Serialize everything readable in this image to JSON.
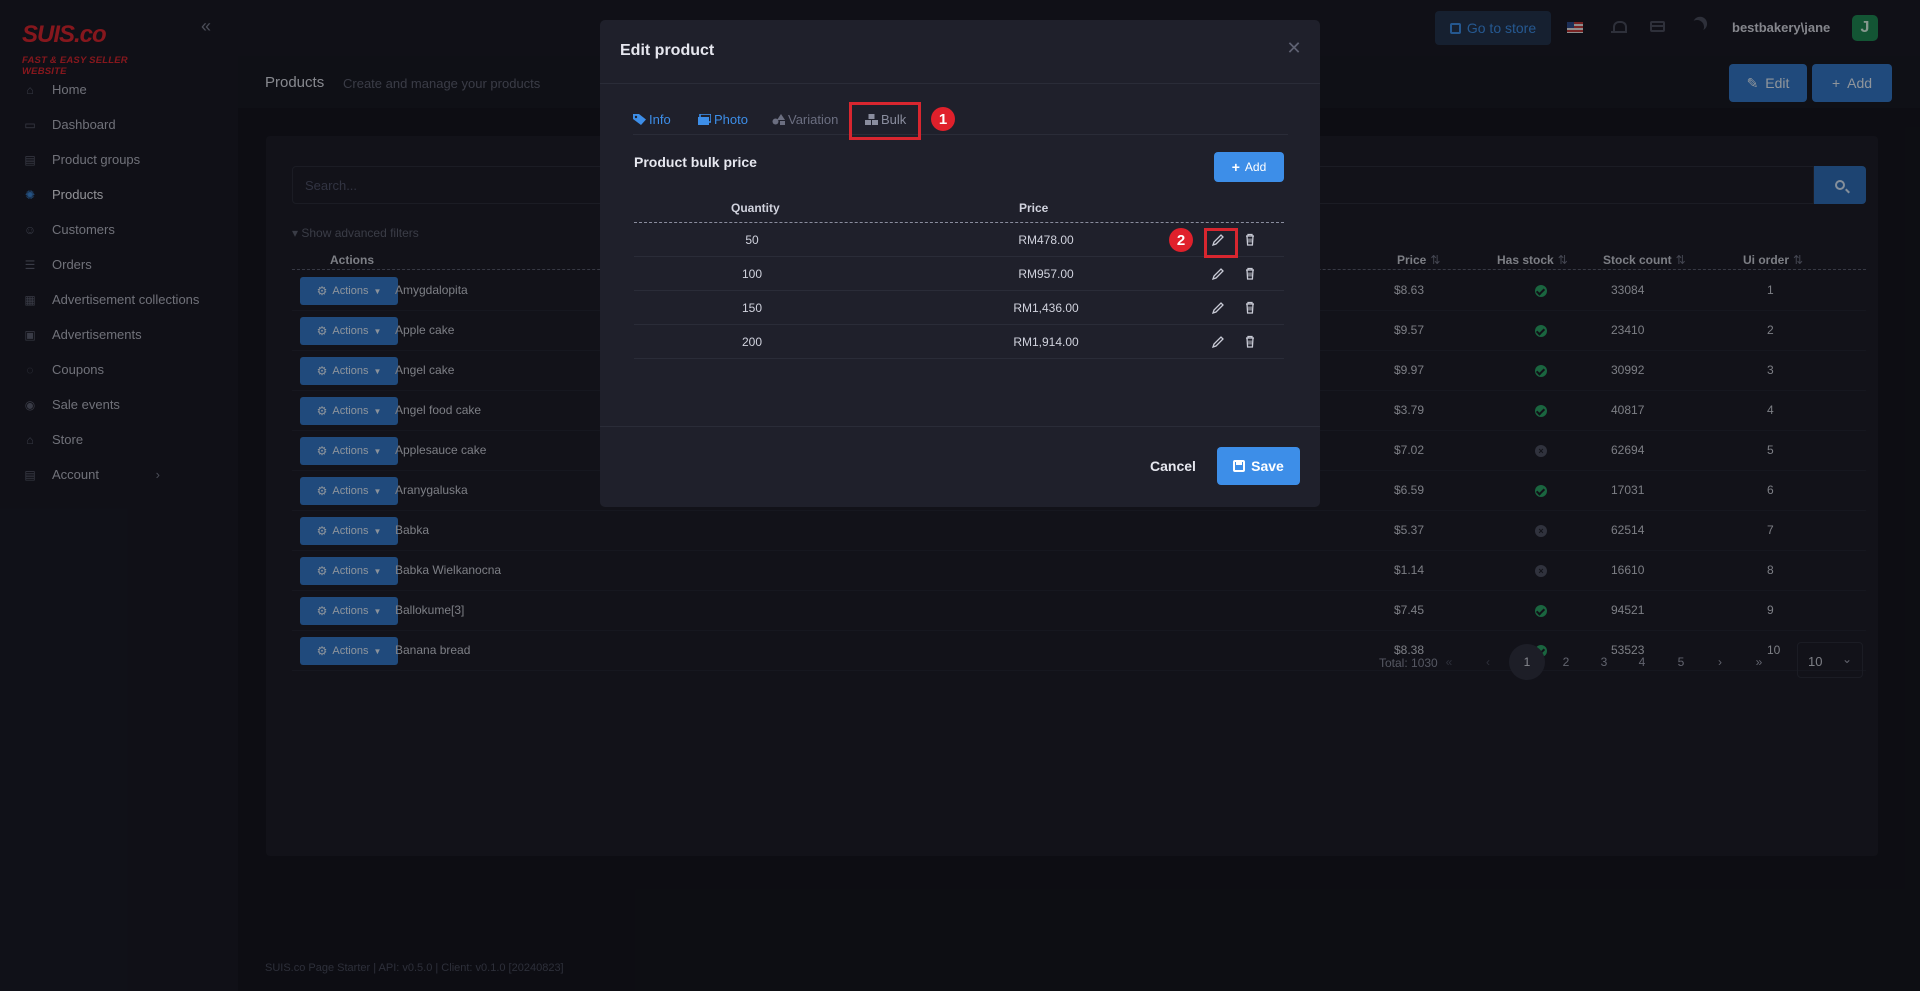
{
  "brand": {
    "logo_main": "SUIS",
    "logo_suffix": ".co",
    "logo_tagline": "FAST & EASY SELLER WEBSITE"
  },
  "sidebar": {
    "items": [
      {
        "label": "Home",
        "icon": "home-icon"
      },
      {
        "label": "Dashboard",
        "icon": "dashboard-icon"
      },
      {
        "label": "Product groups",
        "icon": "product-groups-icon"
      },
      {
        "label": "Products",
        "icon": "products-icon",
        "active": true
      },
      {
        "label": "Customers",
        "icon": "customers-icon"
      },
      {
        "label": "Orders",
        "icon": "orders-icon"
      },
      {
        "label": "Advertisement collections",
        "icon": "ad-collections-icon"
      },
      {
        "label": "Advertisements",
        "icon": "advertisements-icon"
      },
      {
        "label": "Coupons",
        "icon": "coupons-icon"
      },
      {
        "label": "Sale events",
        "icon": "sale-events-icon"
      },
      {
        "label": "Store",
        "icon": "store-icon"
      },
      {
        "label": "Account",
        "icon": "account-icon",
        "chevron": "›"
      }
    ]
  },
  "topbar": {
    "go_to_store": "Go to store",
    "user": "bestbakery\\jane",
    "avatar_initial": "J"
  },
  "page": {
    "title": "Products",
    "subtitle": "Create and manage your products",
    "edit_btn": "Edit",
    "add_btn": "Add"
  },
  "table": {
    "search_placeholder": "Search...",
    "advanced_filters": "Show advanced filters",
    "headers": {
      "actions": "Actions",
      "price": "Price",
      "has_stock": "Has stock",
      "stock_count": "Stock count",
      "ui_order": "Ui order"
    },
    "action_label": "Actions",
    "rows": [
      {
        "name": "Amygdalopita",
        "price": "$8.63",
        "stock": true,
        "count": "33084",
        "order": "1"
      },
      {
        "name": "Apple cake",
        "price": "$9.57",
        "stock": true,
        "count": "23410",
        "order": "2"
      },
      {
        "name": "Angel cake",
        "price": "$9.97",
        "stock": true,
        "count": "30992",
        "order": "3"
      },
      {
        "name": "Angel food cake",
        "price": "$3.79",
        "stock": true,
        "count": "40817",
        "order": "4"
      },
      {
        "name": "Applesauce cake",
        "price": "$7.02",
        "stock": false,
        "count": "62694",
        "order": "5"
      },
      {
        "name": "Aranygaluska",
        "price": "$6.59",
        "stock": true,
        "count": "17031",
        "order": "6"
      },
      {
        "name": "Babka",
        "price": "$5.37",
        "stock": false,
        "count": "62514",
        "order": "7"
      },
      {
        "name": "Babka Wielkanocna",
        "price": "$1.14",
        "stock": false,
        "count": "16610",
        "order": "8"
      },
      {
        "name": "Ballokume[3]",
        "price": "$7.45",
        "stock": true,
        "count": "94521",
        "order": "9"
      },
      {
        "name": "Banana bread",
        "price": "$8.38",
        "stock": true,
        "count": "53523",
        "order": "10"
      }
    ],
    "total": "Total: 1030",
    "pages": [
      "1",
      "2",
      "3",
      "4",
      "5"
    ],
    "current_page": "1",
    "page_size": "10"
  },
  "footer": "SUIS.co Page Starter | API: v0.5.0 | Client: v0.1.0 [20240823]",
  "modal": {
    "title": "Edit product",
    "tabs": {
      "info": "Info",
      "photo": "Photo",
      "variation": "Variation",
      "bulk": "Bulk"
    },
    "section_title": "Product bulk price",
    "add_btn": "Add",
    "col_quantity": "Quantity",
    "col_price": "Price",
    "rows": [
      {
        "quantity": "50",
        "price": "RM478.00"
      },
      {
        "quantity": "100",
        "price": "RM957.00"
      },
      {
        "quantity": "150",
        "price": "RM1,436.00"
      },
      {
        "quantity": "200",
        "price": "RM1,914.00"
      }
    ],
    "cancel": "Cancel",
    "save": "Save"
  },
  "annotations": {
    "badge_1": "1",
    "badge_2": "2",
    "highlight_color": "#d8262f"
  },
  "colors": {
    "accent": "#3d8ee8",
    "button": "#3478c8",
    "stock_ok": "#2aa366",
    "background": "#15161f"
  }
}
